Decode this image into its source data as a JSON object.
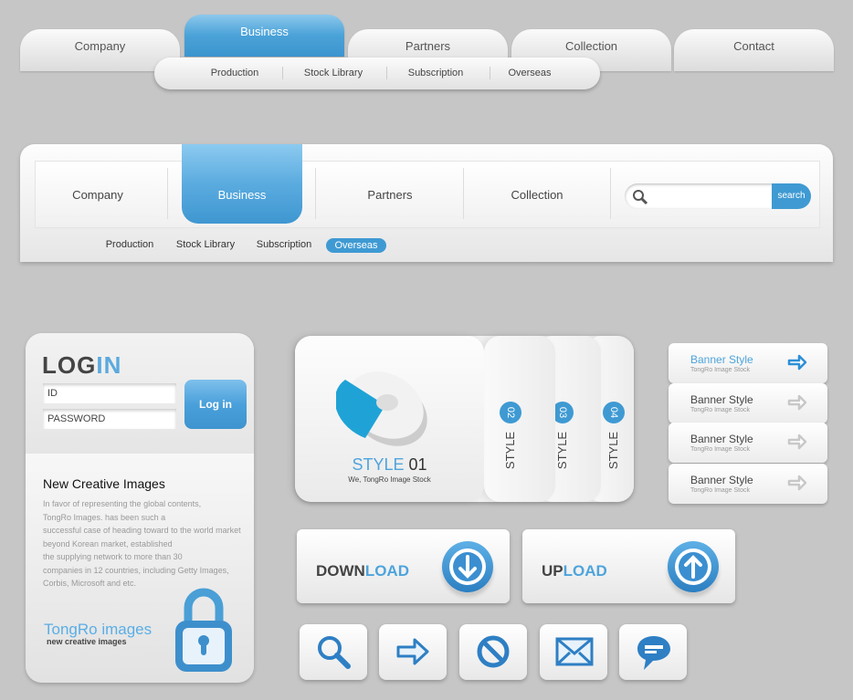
{
  "nav1": {
    "tabs": [
      "Company",
      "Business",
      "Partners",
      "Collection",
      "Contact"
    ],
    "active": "Business",
    "subitems": [
      "Production",
      "Stock Library",
      "Subscription",
      "Overseas"
    ]
  },
  "nav2": {
    "tabs": [
      "Company",
      "Business",
      "Partners",
      "Collection"
    ],
    "active": "Business",
    "search_button": "search",
    "search_placeholder": "",
    "subitems": [
      "Production",
      "Stock Library",
      "Subscription",
      "Overseas"
    ],
    "active_sub": "Overseas"
  },
  "login": {
    "title_a": "LOG",
    "title_b": "IN",
    "id_placeholder": "ID",
    "password_placeholder": "PASSWORD",
    "button": "Log in",
    "heading": "New Creative Images",
    "paragraph": [
      "In favor of representing the global contents,",
      "TongRo Images. has been such a",
      "successful case of heading toward to the world market",
      "beyond Korean market, established",
      "the supplying network to more than 30",
      "companies in 12 countries, including Getty Images,",
      "Corbis, Microsoft and etc."
    ],
    "brand": "TongRo images",
    "brand_sub": "new creative images"
  },
  "styles": {
    "main_a": "STYLE",
    "main_b": "01",
    "main_sub": "We, TongRo Image Stock",
    "tabs": [
      {
        "num": "02",
        "label": "STYLE"
      },
      {
        "num": "03",
        "label": "STYLE"
      },
      {
        "num": "04",
        "label": "STYLE"
      }
    ]
  },
  "banners": [
    {
      "title": "Banner Style",
      "sub": "TongRo Image Stock",
      "active": true
    },
    {
      "title": "Banner Style",
      "sub": "TongRo Image Stock"
    },
    {
      "title": "Banner Style",
      "sub": "TongRo Image Stock"
    },
    {
      "title": "Banner Style",
      "sub": "TongRo Image Stock"
    }
  ],
  "download": {
    "a": "DOWN",
    "b": "LOAD"
  },
  "upload": {
    "a": "UP",
    "b": "LOAD"
  },
  "icons": [
    "search-icon",
    "arrow-right-icon",
    "no-entry-icon",
    "mail-icon",
    "chat-bubble-icon"
  ],
  "colors": {
    "accent": "#3f9ad3",
    "text": "#444444",
    "background": "#c6c6c6"
  }
}
